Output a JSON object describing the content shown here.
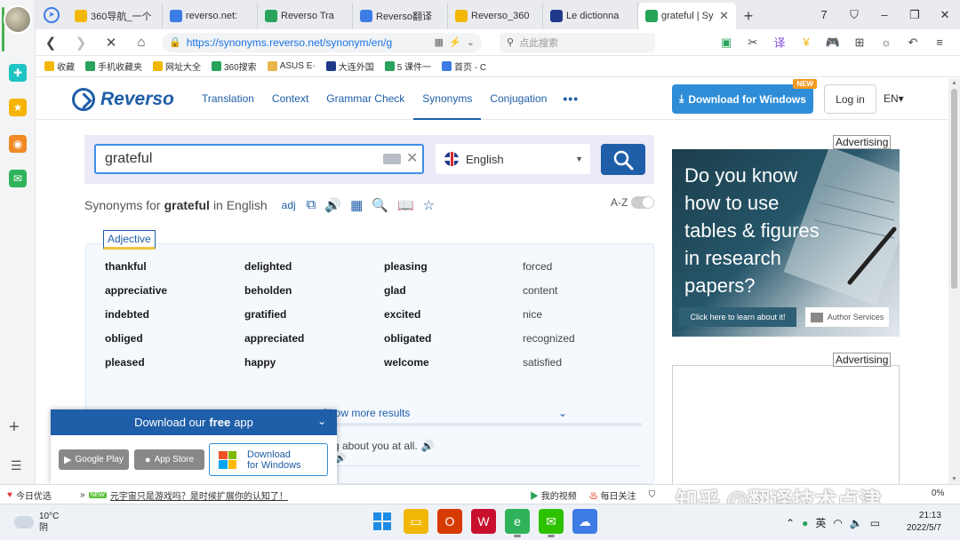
{
  "browser": {
    "tabs": [
      {
        "label": "360导航_一个",
        "icon_color": "#f2b705"
      },
      {
        "label": "reverso.net:",
        "icon_color": "#3d7be5"
      },
      {
        "label": "Reverso Tra",
        "icon_color": "#27a35a"
      },
      {
        "label": "Reverso翻译",
        "icon_color": "#3d7be5"
      },
      {
        "label": "Reverso_360",
        "icon_color": "#f2b705"
      },
      {
        "label": "Le dictionna",
        "icon_color": "#1f3a8a"
      },
      {
        "label": "grateful | Sy",
        "icon_color": "#27a35a",
        "active": true
      }
    ],
    "tab_close": "✕",
    "new_tab": "+",
    "window_controls": [
      "7",
      "⛉",
      "–",
      "❐",
      "✕"
    ],
    "url": "https://synonyms.reverso.net/synonym/en/g",
    "search_placeholder": "点此搜索",
    "bookmarks": [
      {
        "label": "收藏",
        "color": "#f2b705"
      },
      {
        "label": "手机收藏夹",
        "color": "#27a35a"
      },
      {
        "label": "网址大全",
        "color": "#f2b705"
      },
      {
        "label": "360搜索",
        "color": "#27a35a"
      },
      {
        "label": "ASUS E·",
        "color": "#e8b64a"
      },
      {
        "label": "大连外国",
        "color": "#1f3a8a"
      },
      {
        "label": "5 课件一",
        "color": "#27a35a"
      },
      {
        "label": "首页 - C",
        "color": "#3d7be5"
      }
    ]
  },
  "site": {
    "logo": "Reverso",
    "nav": [
      {
        "label": "Translation"
      },
      {
        "label": "Context"
      },
      {
        "label": "Grammar Check"
      },
      {
        "label": "Synonyms",
        "active": true
      },
      {
        "label": "Conjugation"
      }
    ],
    "nav_more": "•••",
    "download_button": "Download for Windows",
    "new_badge": "NEW",
    "login": "Log in",
    "lang": "EN▾"
  },
  "search": {
    "query": "grateful",
    "language": "English"
  },
  "results_header": {
    "prefix": "Synonyms for",
    "word": "grateful",
    "suffix": "in English",
    "pos": "adj",
    "az_label": "A-Z"
  },
  "results": {
    "section_tab": "Adjective",
    "synonyms": [
      {
        "w": "thankful",
        "bold": true
      },
      {
        "w": "delighted",
        "bold": true
      },
      {
        "w": "pleasing",
        "bold": true
      },
      {
        "w": "forced",
        "bold": false
      },
      {
        "w": "appreciative",
        "bold": true
      },
      {
        "w": "beholden",
        "bold": true
      },
      {
        "w": "glad",
        "bold": true
      },
      {
        "w": "content",
        "bold": false
      },
      {
        "w": "indebted",
        "bold": true
      },
      {
        "w": "gratified",
        "bold": true
      },
      {
        "w": "excited",
        "bold": true
      },
      {
        "w": "nice",
        "bold": false
      },
      {
        "w": "obliged",
        "bold": true
      },
      {
        "w": "appreciated",
        "bold": true
      },
      {
        "w": "obligated",
        "bold": true
      },
      {
        "w": "recognized",
        "bold": false
      },
      {
        "w": "pleased",
        "bold": true
      },
      {
        "w": "happy",
        "bold": true
      },
      {
        "w": "welcome",
        "bold": true
      },
      {
        "w": "satisfied",
        "bold": false
      }
    ],
    "show_more": "Show more results",
    "example_partial": "g about you at all."
  },
  "ads": {
    "label": "Advertising",
    "ad1_text": "Do you know how to use tables & figures in research papers?",
    "ad1_cta": "Click here to learn about it!",
    "ad1_brand": "Author Services"
  },
  "app_popup": {
    "title_prefix": "Download our",
    "title_bold": "free",
    "title_suffix": "app",
    "google_play": "Google Play",
    "app_store": "App Store",
    "windows_line1": "Download",
    "windows_line2": "for Windows"
  },
  "statusbar": {
    "left": "今日优选",
    "news_badge": "NEW",
    "news": "元宇宙只是游戏吗？是时候扩展你的认知了！",
    "right_items": [
      "我的视频",
      "每日关注"
    ],
    "watermark": "知乎 @翻译技术点津",
    "zoom": "0%"
  },
  "taskbar": {
    "temp": "10°C",
    "weather": "阴",
    "ime": "英",
    "time": "21:13",
    "date": "2022/5/7"
  }
}
